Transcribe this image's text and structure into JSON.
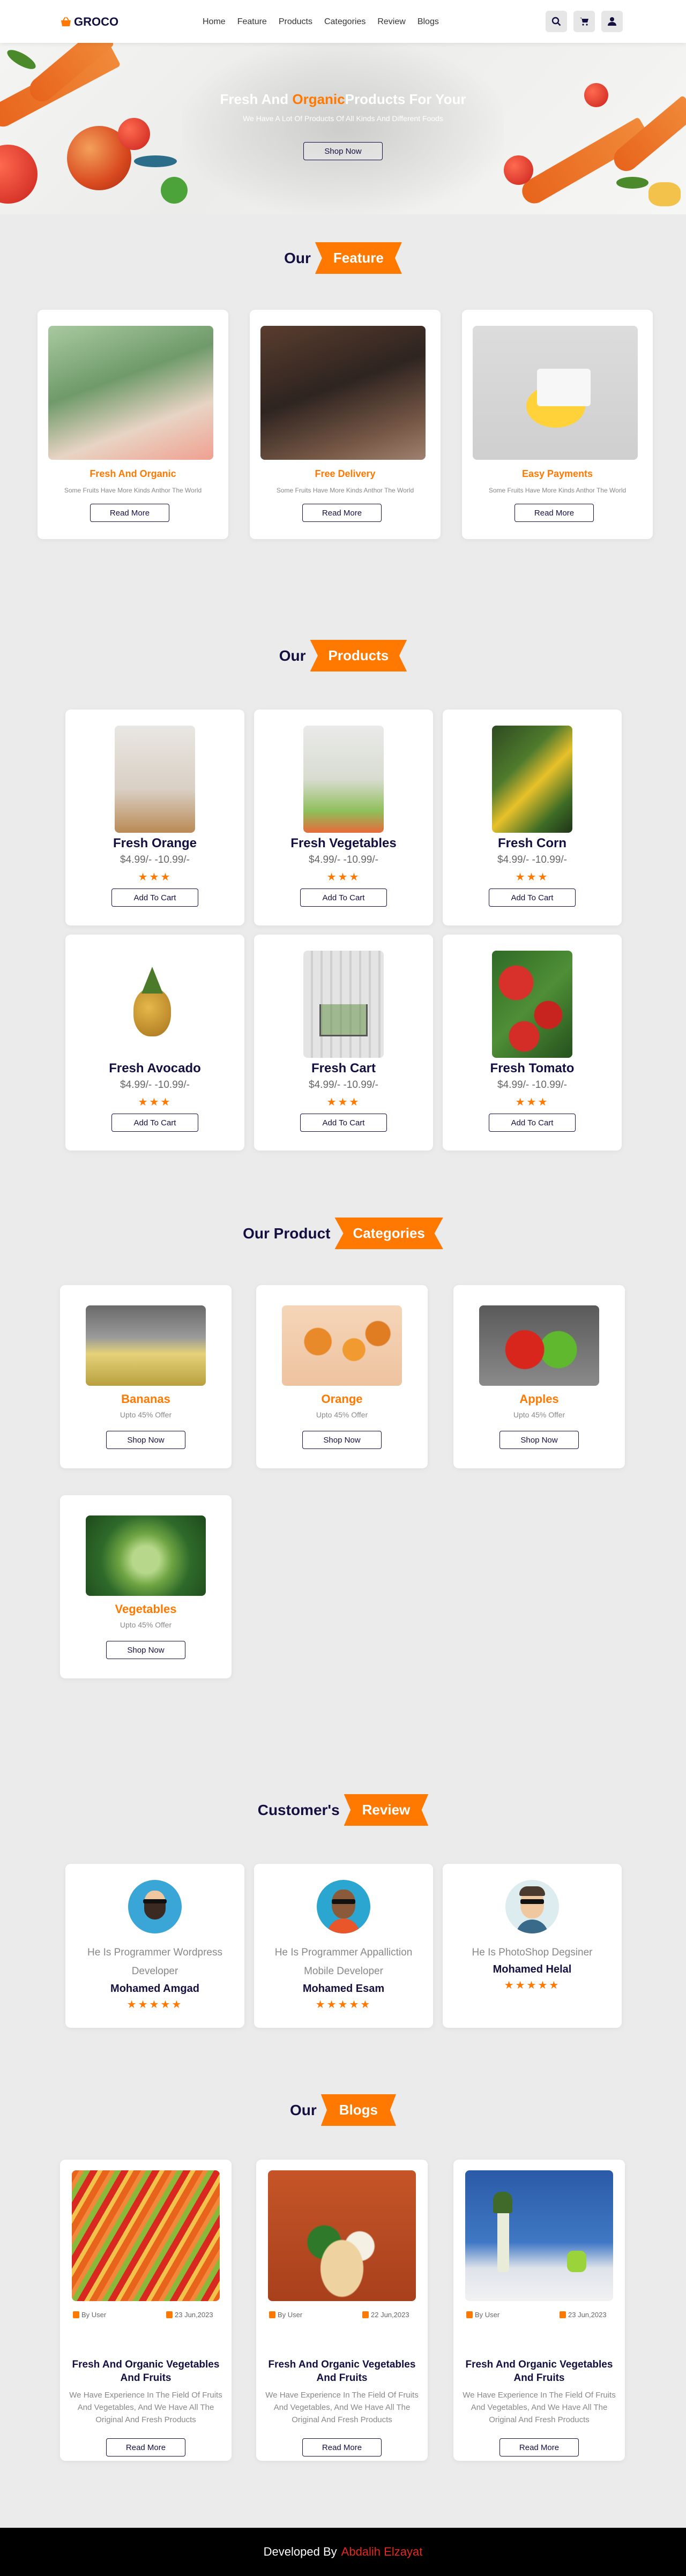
{
  "brand": {
    "name": "GROCO",
    "accent": "#ff7800",
    "dark": "#130f40"
  },
  "nav": [
    "Home",
    "Feature",
    "Products",
    "Categories",
    "Review",
    "Blogs"
  ],
  "header_icons": [
    "search-icon",
    "cart-icon",
    "user-icon"
  ],
  "hero": {
    "title_part1": "Fresh And ",
    "title_highlight": "Organic",
    "title_part2": "Products For Your",
    "subtitle": "We Have A Lot Of Products Of All Kinds And Different Foods",
    "button": "Shop Now"
  },
  "features": {
    "heading_plain": "Our",
    "heading_tag": "Feature",
    "items": [
      {
        "title": "Fresh And Organic",
        "desc": "Some Fruits Have More Kinds Anthor The World",
        "button": "Read More"
      },
      {
        "title": "Free Delivery",
        "desc": "Some Fruits Have More Kinds Anthor The World",
        "button": "Read More"
      },
      {
        "title": "Easy Payments",
        "desc": "Some Fruits Have More Kinds Anthor The World",
        "button": "Read More"
      }
    ]
  },
  "products": {
    "heading_plain": "Our",
    "heading_tag": "Products",
    "items": [
      {
        "name": "Fresh Orange",
        "price": "$4.99/- -10.99/-",
        "stars": "★★★",
        "button": "Add To Cart"
      },
      {
        "name": "Fresh Vegetables",
        "price": "$4.99/- -10.99/-",
        "stars": "★★★",
        "button": "Add To Cart"
      },
      {
        "name": "Fresh Corn",
        "price": "$4.99/- -10.99/-",
        "stars": "★★★",
        "button": "Add To Cart"
      },
      {
        "name": "Fresh Avocado",
        "price": "$4.99/- -10.99/-",
        "stars": "★★★",
        "button": "Add To Cart"
      },
      {
        "name": "Fresh Cart",
        "price": "$4.99/- -10.99/-",
        "stars": "★★★",
        "button": "Add To Cart"
      },
      {
        "name": "Fresh Tomato",
        "price": "$4.99/- -10.99/-",
        "stars": "★★★",
        "button": "Add To Cart"
      }
    ]
  },
  "categories": {
    "heading_plain": "Our Product",
    "heading_tag": "Categories",
    "items": [
      {
        "name": "Bananas",
        "offer": "Upto 45% Offer",
        "button": "Shop Now"
      },
      {
        "name": "Orange",
        "offer": "Upto 45% Offer",
        "button": "Shop Now"
      },
      {
        "name": "Apples",
        "offer": "Upto 45% Offer",
        "button": "Shop Now"
      },
      {
        "name": "Vegetables",
        "offer": "Upto 45% Offer",
        "button": "Shop Now"
      }
    ]
  },
  "reviews": {
    "heading_plain": "Customer's",
    "heading_tag": "Review",
    "items": [
      {
        "desc": "He Is Programmer Wordpress Developer",
        "name": "Mohamed Amgad",
        "stars": "★★★★★"
      },
      {
        "desc": "He Is Programmer Appalliction Mobile Developer",
        "name": "Mohamed Esam",
        "stars": "★★★★★"
      },
      {
        "desc": "He Is PhotoShop Degsiner",
        "name": "Mohamed Helal",
        "stars": "★★★★★"
      }
    ]
  },
  "blogs": {
    "heading_plain": "Our",
    "heading_tag": "Blogs",
    "items": [
      {
        "user": "By User",
        "date": "23 Jun,2023",
        "title": "Fresh And Organic Vegetables And Fruits",
        "desc": "We Have Experience In The Field Of Fruits And Vegetables, And We Have All The Original And Fresh Products",
        "button": "Read More"
      },
      {
        "user": "By User",
        "date": "22 Jun,2023",
        "title": "Fresh And Organic Vegetables And Fruits",
        "desc": "We Have Experience In The Field Of Fruits And Vegetables, And We Have All The Original And Fresh Products",
        "button": "Read More"
      },
      {
        "user": "By User",
        "date": "23 Jun,2023",
        "title": "Fresh And Organic Vegetables And Fruits",
        "desc": "We Have Experience In The Field Of Fruits And Vegetables, And We Have All The Original And Fresh Products",
        "button": "Read More"
      }
    ]
  },
  "footer": {
    "prefix": "Developed By",
    "developer": "Abdalih Elzayat"
  }
}
